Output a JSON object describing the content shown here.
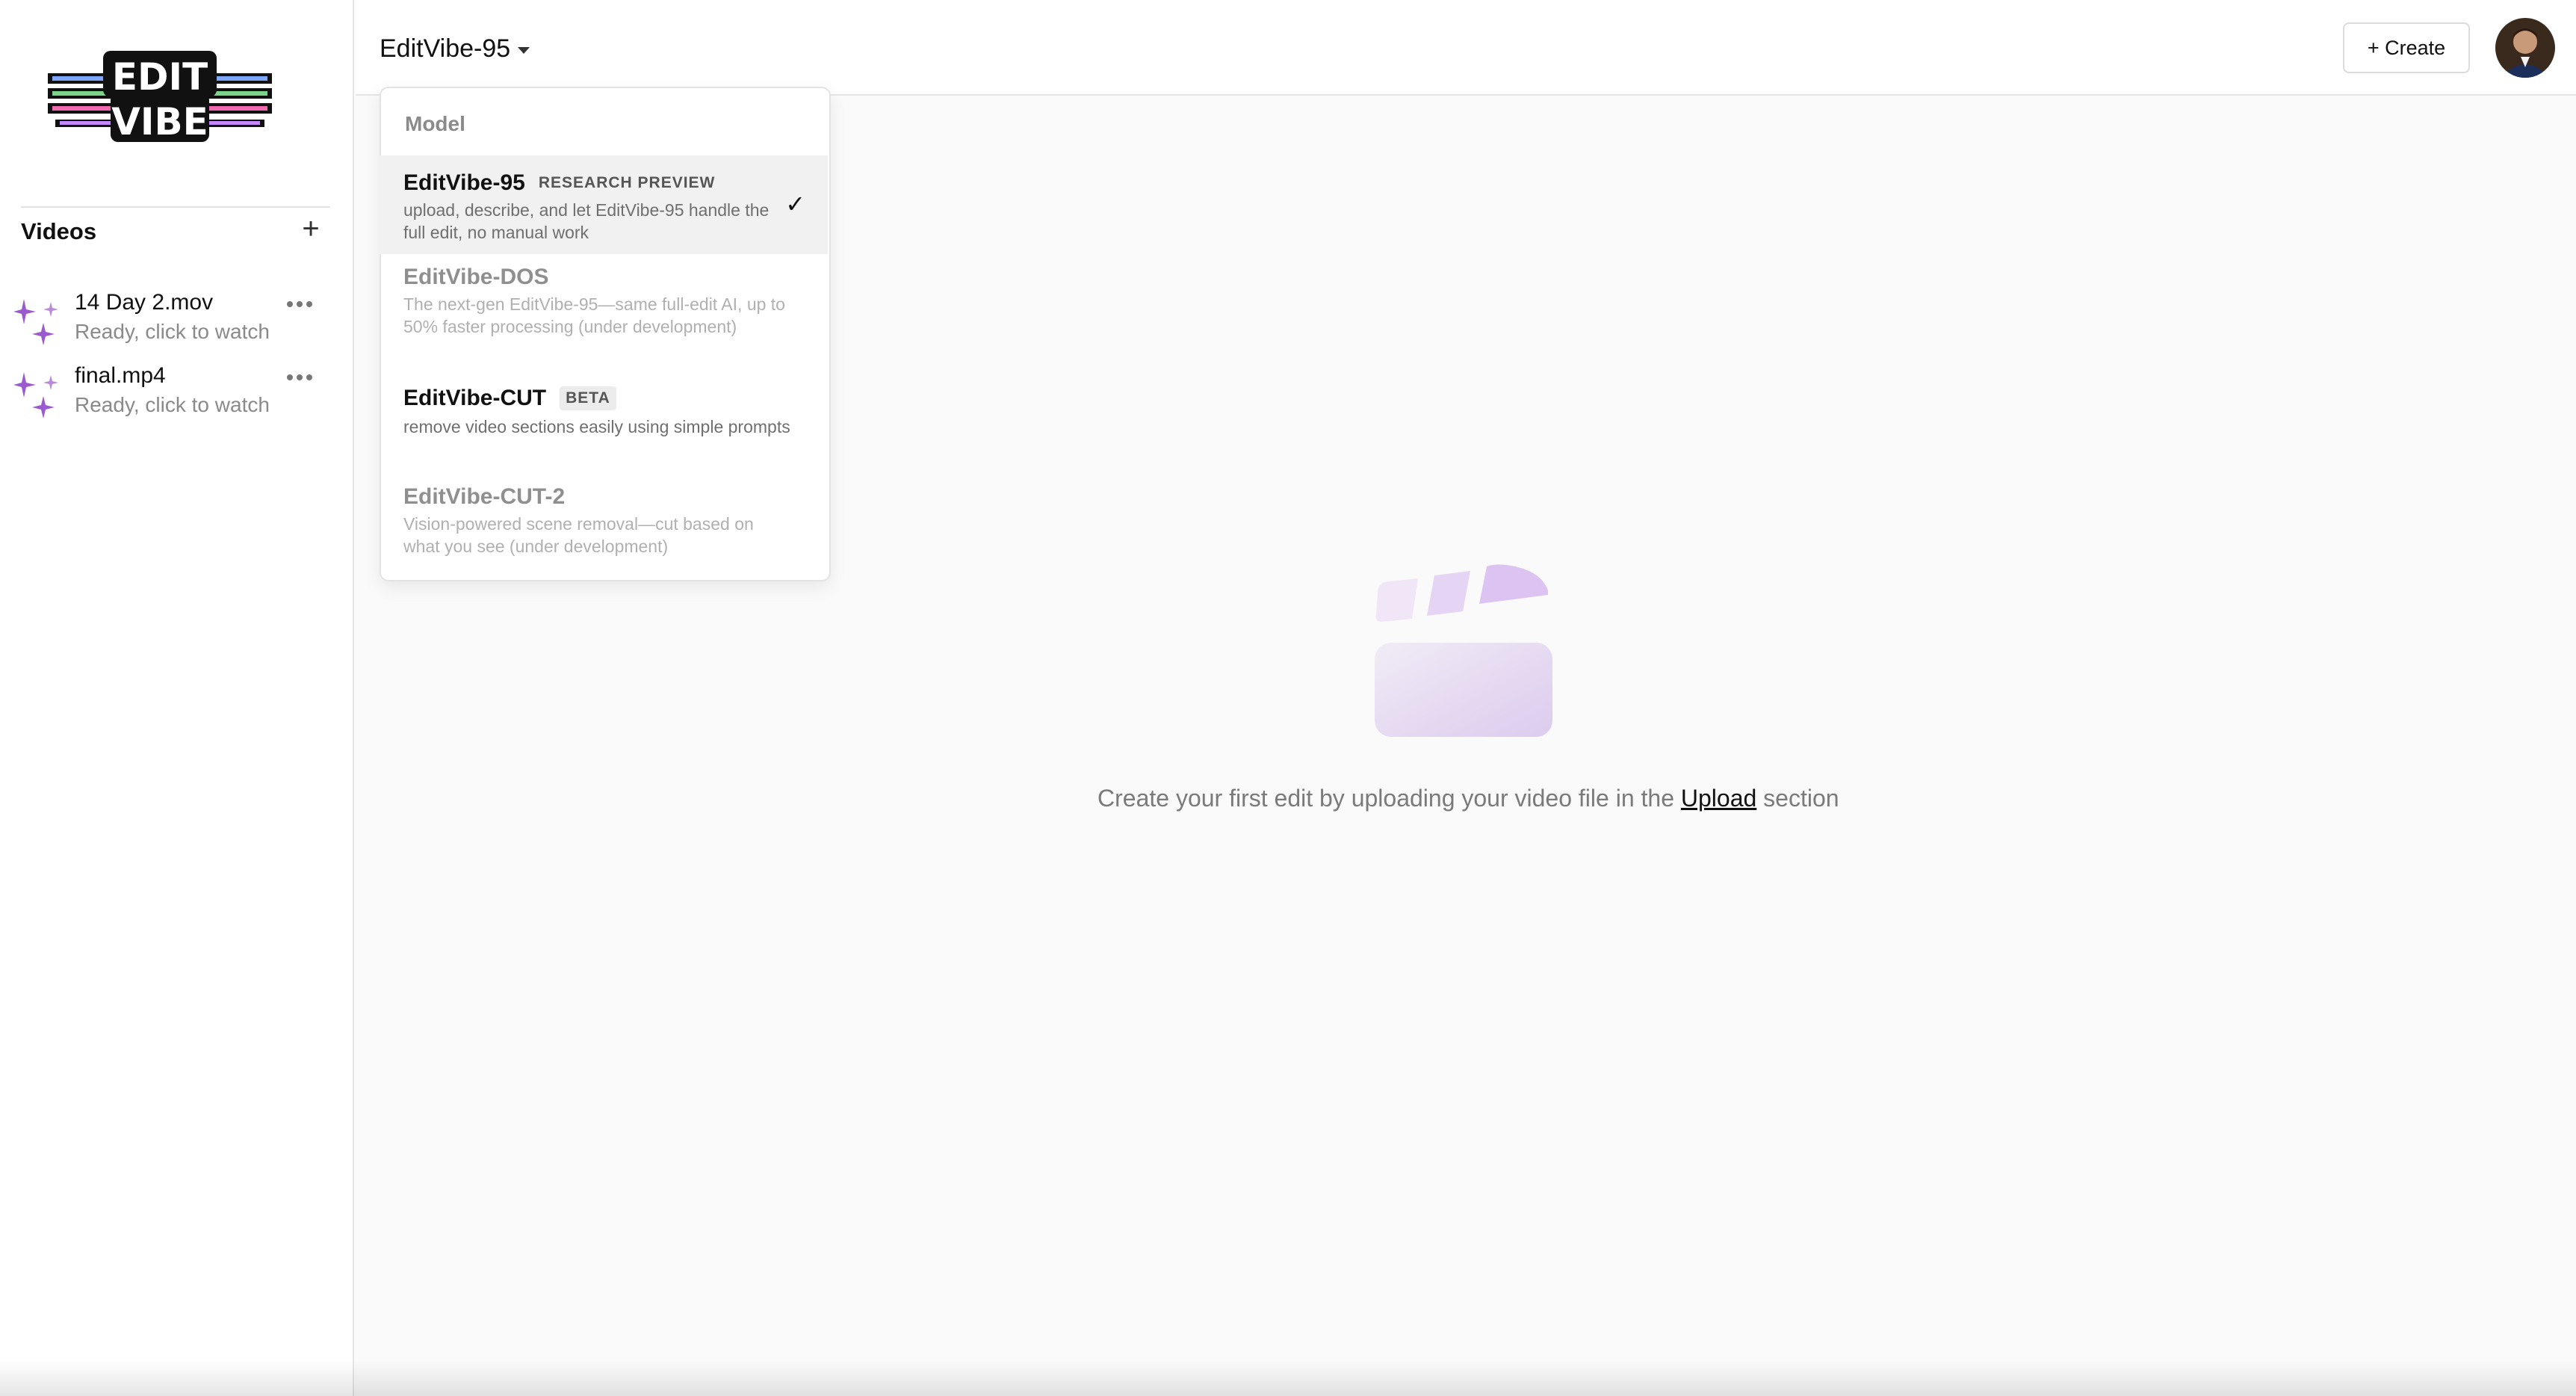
{
  "app": {
    "logo_text_top": "EDIT",
    "logo_text_bottom": "VIBE"
  },
  "sidebar": {
    "section_title": "Videos",
    "add_icon": "plus-icon",
    "videos": [
      {
        "name": "14 Day 2.mov",
        "status": "Ready, click to watch"
      },
      {
        "name": "final.mp4",
        "status": "Ready, click to watch"
      }
    ]
  },
  "topbar": {
    "model_label": "EditVibe-95",
    "create_label": "+ Create"
  },
  "dropdown": {
    "header": "Model",
    "options": [
      {
        "title": "EditVibe-95",
        "badge": "RESEARCH PREVIEW",
        "desc": "upload, describe, and let EditVibe-95 handle the full edit, no manual work",
        "selected": true,
        "check": "✓"
      },
      {
        "title": "EditVibe-DOS",
        "badge": "",
        "desc": "The next-gen EditVibe-95—same full-edit AI, up to 50% faster processing (under development)",
        "disabled": true
      },
      {
        "title": "EditVibe-CUT",
        "badge": "BETA",
        "desc": "remove video sections easily using simple prompts"
      },
      {
        "title": "EditVibe-CUT-2",
        "badge": "",
        "desc": "Vision-powered scene removal—cut based on what you see (under development)",
        "disabled": true
      }
    ]
  },
  "empty_state": {
    "text_before": "Create your first edit by uploading your video file in the ",
    "link": "Upload",
    "text_after": " section"
  },
  "colors": {
    "accent_purple": "#9b59d0",
    "illustration_light": "#e4d6f2"
  }
}
